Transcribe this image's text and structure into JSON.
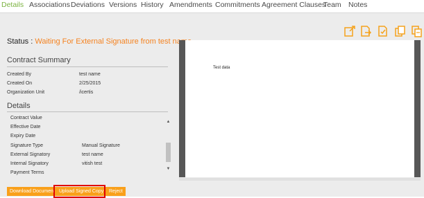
{
  "tabs": [
    "Details",
    "Associations",
    "Deviations",
    "Versions",
    "History",
    "Amendments",
    "Commitments",
    "Agreement Clauses",
    "Team",
    "Notes"
  ],
  "active_tab": "Details",
  "toolbar_icons": [
    "export-icon",
    "document-share-icon",
    "document-check-icon",
    "copy-document-icon",
    "duplicate-document-icon"
  ],
  "status": {
    "label": "Status :",
    "value": "Waiting For External Signature from test name"
  },
  "contract_summary": {
    "title": "Contract Summary",
    "rows": [
      {
        "label": "Created By",
        "value": "test name"
      },
      {
        "label": "Created On",
        "value": "2/25/2015"
      },
      {
        "label": "Organization Unit",
        "value": "/icertis"
      }
    ]
  },
  "details": {
    "title": "Details",
    "rows": [
      {
        "label": "Contract Value",
        "value": ""
      },
      {
        "label": "Effective Date",
        "value": ""
      },
      {
        "label": "Expiry Date",
        "value": ""
      },
      {
        "label": "Signature Type",
        "value": "Manual Signature"
      },
      {
        "label": "External Signatory",
        "value": "test name"
      },
      {
        "label": "Internal Signatory",
        "value": "vitish test"
      },
      {
        "label": "Payment Terms",
        "value": ""
      }
    ]
  },
  "preview": {
    "text": "Test data"
  },
  "buttons": {
    "download": "Download Document",
    "upload": "Upload Signed Copy",
    "reject": "Reject"
  },
  "colors": {
    "accent_orange": "#f5821f",
    "button_orange": "#f9a01b",
    "active_tab_green": "#7cb342",
    "highlight_red": "#e00000"
  }
}
